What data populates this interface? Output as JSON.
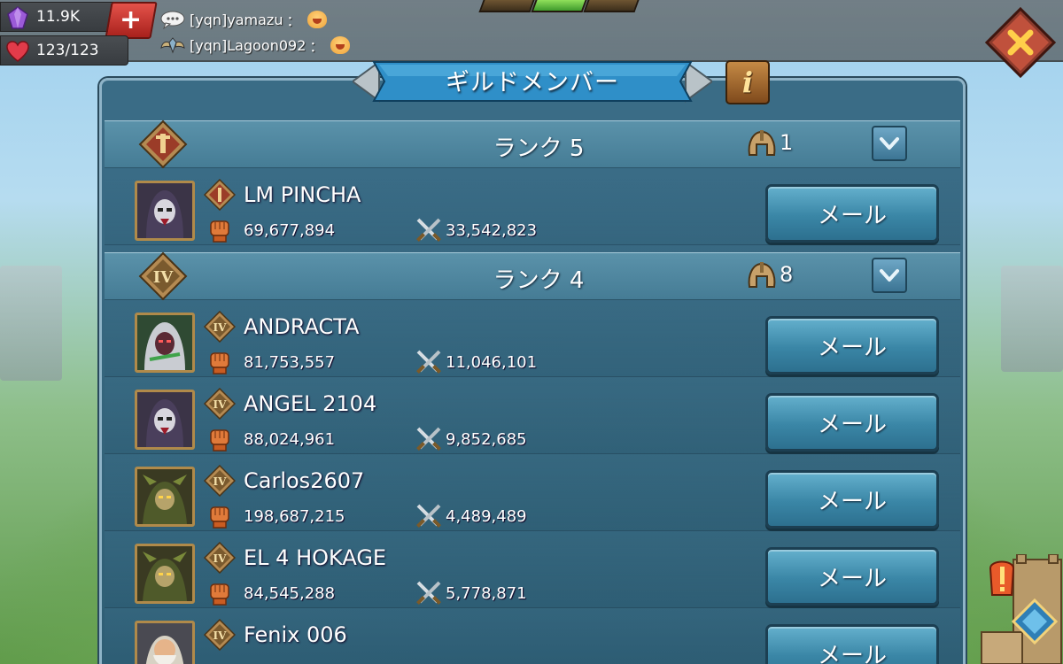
{
  "resources": {
    "gems": "11.9K",
    "stamina": "123/123"
  },
  "chat": [
    {
      "user": "[yqn]yamazu",
      "sep": "："
    },
    {
      "user": "[yqn]Lagoon092",
      "sep": "："
    }
  ],
  "panel": {
    "title": "ギルドメンバー",
    "info_label": "i"
  },
  "ranks": [
    {
      "title": "ランク 5",
      "count": "1",
      "members": [
        {
          "name": "LM PINCHA",
          "might": "69,677,894",
          "kills": "33,542,823",
          "mail": "メール"
        }
      ]
    },
    {
      "title": "ランク 4",
      "count": "8",
      "members": [
        {
          "name": "ANDRACTA",
          "might": "81,753,557",
          "kills": "11,046,101",
          "mail": "メール"
        },
        {
          "name": "ANGEL 2104",
          "might": "88,024,961",
          "kills": "9,852,685",
          "mail": "メール"
        },
        {
          "name": "Carlos2607",
          "might": "198,687,215",
          "kills": "4,489,489",
          "mail": "メール"
        },
        {
          "name": "EL 4 HOKAGE",
          "might": "84,545,288",
          "kills": "5,778,871",
          "mail": "メール"
        },
        {
          "name": "Fenix 006",
          "mail": "メール"
        }
      ]
    }
  ],
  "colors": {
    "panel": "#336684",
    "button": "#3a86a6",
    "accent_gold": "#b08a4a",
    "close": "#c0392b"
  }
}
